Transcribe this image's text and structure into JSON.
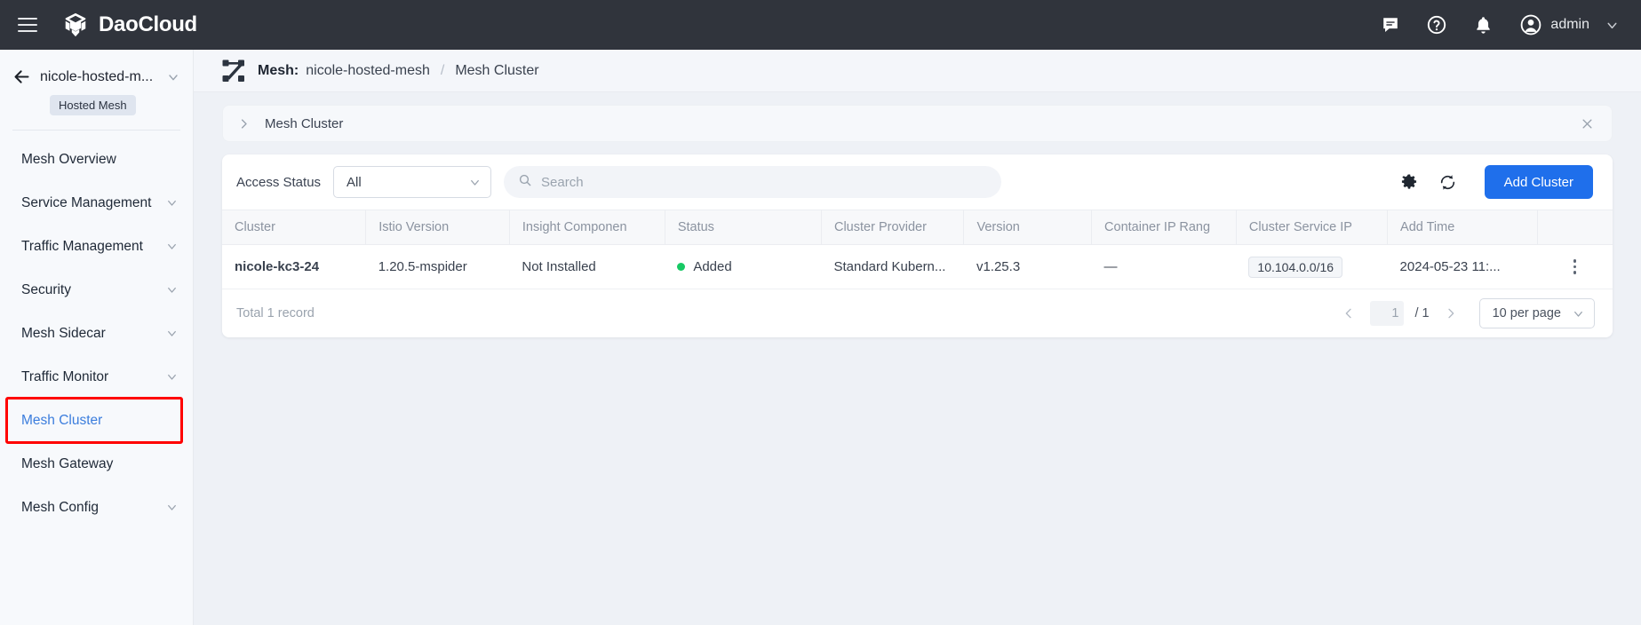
{
  "topbar": {
    "brand": "DaoCloud",
    "menu_icon": "hamburger-icon",
    "chat_icon": "chat-icon",
    "help_icon": "help-icon",
    "bell_icon": "bell-icon",
    "avatar_icon": "avatar-icon",
    "user": "admin"
  },
  "sidebar": {
    "back_icon": "back-arrow-icon",
    "mesh_name": "nicole-hosted-m...",
    "badge": "Hosted Mesh",
    "items": [
      {
        "label": "Mesh Overview",
        "expandable": false,
        "active": false
      },
      {
        "label": "Service Management",
        "expandable": true,
        "active": false
      },
      {
        "label": "Traffic Management",
        "expandable": true,
        "active": false
      },
      {
        "label": "Security",
        "expandable": true,
        "active": false
      },
      {
        "label": "Mesh Sidecar",
        "expandable": true,
        "active": false
      },
      {
        "label": "Traffic Monitor",
        "expandable": true,
        "active": false
      },
      {
        "label": "Mesh Cluster",
        "expandable": false,
        "active": true
      },
      {
        "label": "Mesh Gateway",
        "expandable": false,
        "active": false
      },
      {
        "label": "Mesh Config",
        "expandable": true,
        "active": false
      }
    ],
    "highlight_color": "#ff0000"
  },
  "breadcrumb": {
    "icon": "mesh-icon",
    "label": "Mesh:",
    "mesh": "nicole-hosted-mesh",
    "separator": "/",
    "current": "Mesh Cluster"
  },
  "collapse_panel": {
    "chevron_icon": "chevron-right-icon",
    "title": "Mesh Cluster",
    "close_icon": "close-icon"
  },
  "toolbar": {
    "filter_label": "Access Status",
    "filter_value": "All",
    "search_placeholder": "Search",
    "search_value": "",
    "search_icon": "search-icon",
    "settings_icon": "gear-icon",
    "refresh_icon": "refresh-icon",
    "add_button": "Add Cluster",
    "accent_color": "#1f6feb"
  },
  "table": {
    "columns": [
      "Cluster",
      "Istio Version",
      "Insight Componen",
      "Status",
      "Cluster Provider",
      "Version",
      "Container IP Rang",
      "Cluster Service IP",
      "Add Time",
      ""
    ],
    "rows": [
      {
        "cluster": "nicole-kc3-24",
        "istio_version": "1.20.5-mspider",
        "insight_component": "Not Installed",
        "status": "Added",
        "status_color": "#17c964",
        "cluster_provider": "Standard Kubern...",
        "version": "v1.25.3",
        "container_ip_range": "—",
        "cluster_service_ip": "10.104.0.0/16",
        "add_time": "2024-05-23 11:...",
        "actions_icon": "kebab-menu-icon"
      }
    ]
  },
  "footer": {
    "total": "Total 1 record",
    "prev_icon": "chevron-left-icon",
    "next_icon": "chevron-right-icon",
    "page": "1",
    "page_of": "/ 1",
    "page_size": "10 per page",
    "page_size_chevron": "chevron-down-icon"
  }
}
